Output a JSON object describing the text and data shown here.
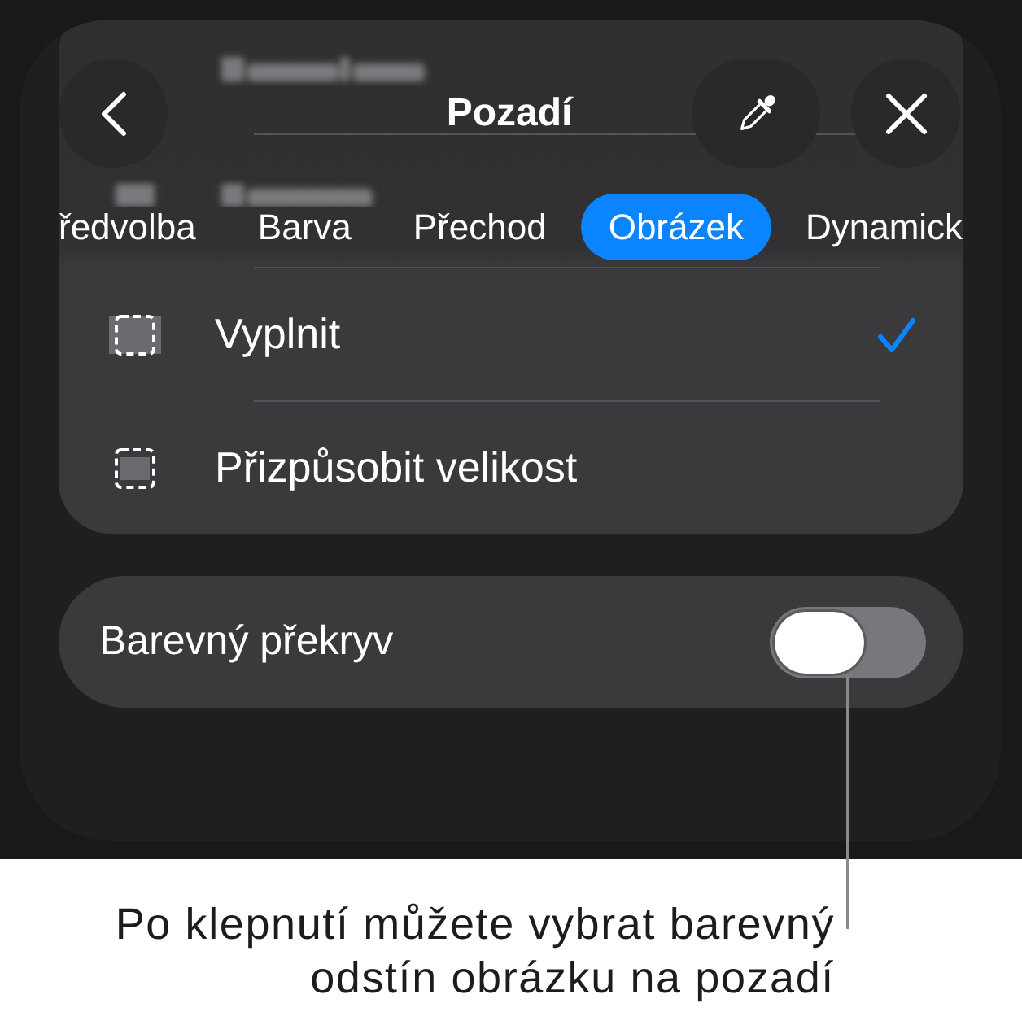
{
  "sheet": {
    "title": "Pozadí"
  },
  "tabs": [
    {
      "label": "ředvolba",
      "selected": false
    },
    {
      "label": "Barva",
      "selected": false
    },
    {
      "label": "Přechod",
      "selected": false
    },
    {
      "label": "Obrázek",
      "selected": true
    },
    {
      "label": "Dynamick",
      "selected": false
    }
  ],
  "options": [
    {
      "kind": "fill",
      "label": "Vyplnit",
      "selected": true
    },
    {
      "kind": "fit",
      "label": "Přizpůsobit velikost",
      "selected": false
    }
  ],
  "overlay_toggle": {
    "label": "Barevný překryv",
    "on": false
  },
  "callout": {
    "text": "Po klepnutí můžete vybrat barevný odstín obrázku na pozadí"
  }
}
